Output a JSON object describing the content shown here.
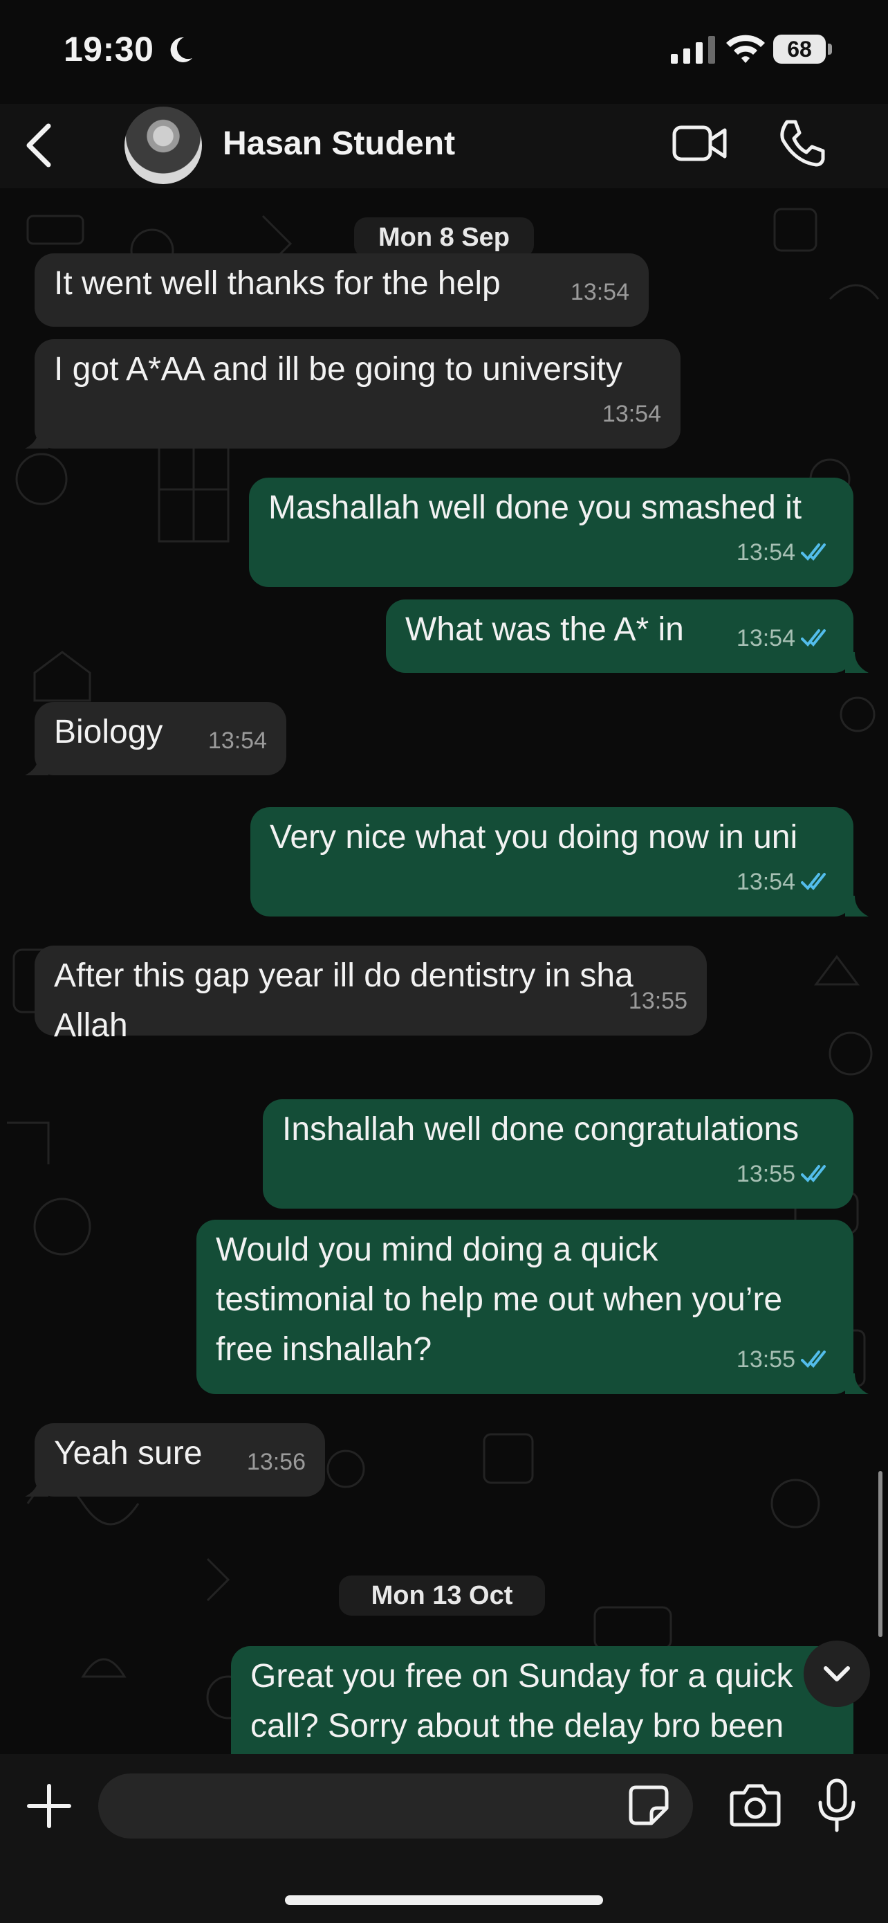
{
  "status_bar": {
    "time": "19:30",
    "battery": "68"
  },
  "header": {
    "contact_name": "Hasan Student"
  },
  "dates": [
    "Mon 8 Sep",
    "Mon 13 Oct"
  ],
  "messages": [
    {
      "dir": "in",
      "text": "It went well thanks for the help",
      "time": "13:54"
    },
    {
      "dir": "in",
      "text": "I got A*AA and ill be going to university",
      "time": "13:54"
    },
    {
      "dir": "out",
      "text": "Mashallah well done you smashed it",
      "time": "13:54"
    },
    {
      "dir": "out",
      "text": "What was the A* in",
      "time": "13:54"
    },
    {
      "dir": "in",
      "text": "Biology",
      "time": "13:54"
    },
    {
      "dir": "out",
      "text": "Very nice what you doing now in uni",
      "time": "13:54"
    },
    {
      "dir": "in",
      "text": "After this gap year ill do dentistry in sha\nAllah",
      "time": "13:55"
    },
    {
      "dir": "out",
      "text": "Inshallah well done congratulations",
      "time": "13:55"
    },
    {
      "dir": "out",
      "text": "Would you mind doing a quick\ntestimonial to help me out when you’re\nfree inshallah?",
      "time": "13:55"
    },
    {
      "dir": "in",
      "text": "Yeah sure",
      "time": "13:56"
    },
    {
      "dir": "out",
      "text": "Great you free on Sunday for a quick\ncall? Sorry about the delay bro been",
      "time": ""
    }
  ],
  "input": {
    "value": "",
    "placeholder": ""
  },
  "colors": {
    "incoming": "#262626",
    "outgoing": "#144d37",
    "read_ticks": "#53bdeb",
    "background": "#0b0b0b"
  }
}
